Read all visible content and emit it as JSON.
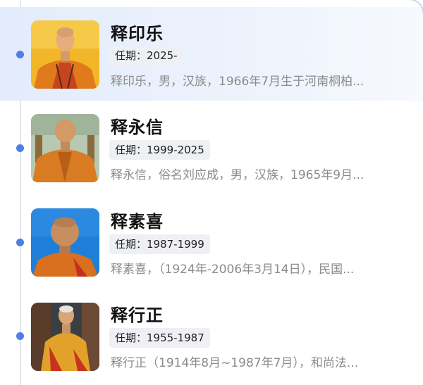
{
  "abbots": [
    {
      "name": "释印乐",
      "term": "任期：2025-",
      "summary": "释印乐，男，汉族，1966年7月生于河南桐柏...",
      "selected": true
    },
    {
      "name": "释永信",
      "term": "任期：1999-2025",
      "summary": "释永信，俗名刘应成，男，汉族，1965年9月...",
      "selected": false
    },
    {
      "name": "释素喜",
      "term": "任期：1987-1999",
      "summary": "释素喜，（1924年-2006年3月14日），民国...",
      "selected": false
    },
    {
      "name": "释行正",
      "term": "任期：1955-1987",
      "summary": "释行正（1914年8月~1987年7月），和尚法...",
      "selected": false
    }
  ],
  "colors": {
    "accent": "#4e7ee8",
    "selected_bg": "#e8effc",
    "term_chip_bg": "#eef0f4",
    "summary_text": "#8b8b8b"
  }
}
